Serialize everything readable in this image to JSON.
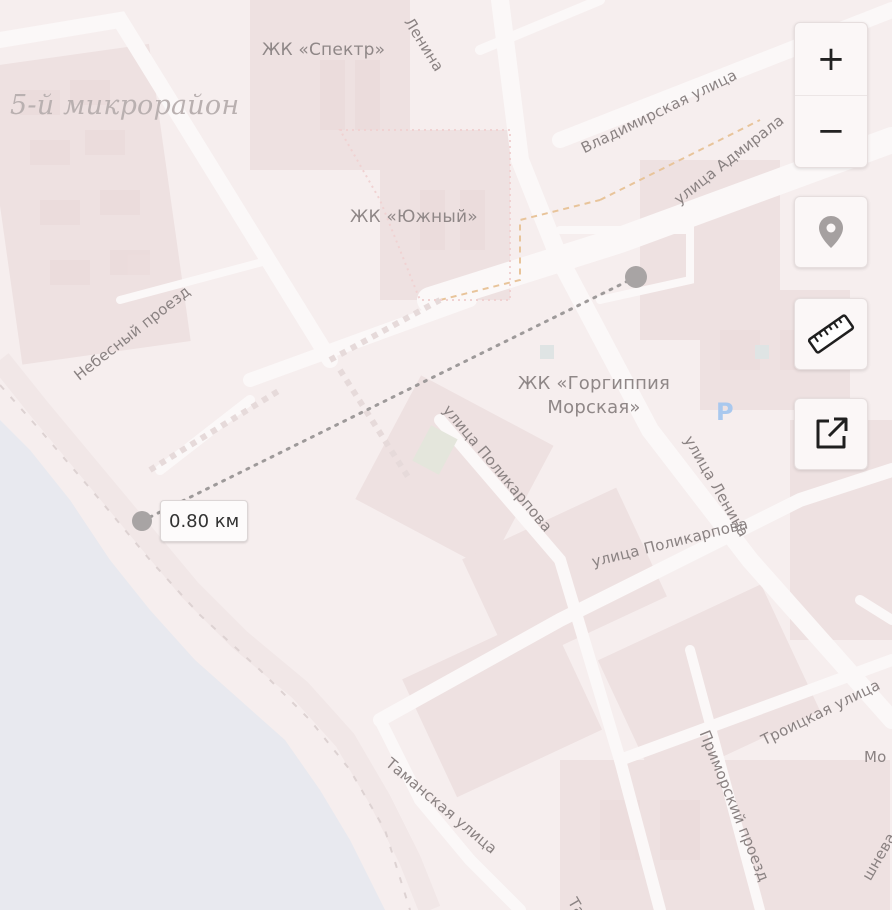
{
  "map": {
    "labels": {
      "district": "5-й микрорайон",
      "zk_spektr": "ЖК «Спектр»",
      "zk_yuzhny": "ЖК «Южный»",
      "zk_gorgippia_line1": "ЖК «Горгиппия",
      "zk_gorgippia_line2": "Морская»",
      "parking": "P",
      "vladimirskaya": "Владимирская улица",
      "admirala": "улица Адмирала",
      "lenina_top": "Ленина",
      "lenina": "улица Ленина",
      "nebesny": "Небесный проезд",
      "polikarpova_1": "улица Поликарпова",
      "polikarpova_2": "улица Поликарпова",
      "troitskaya": "Троицкая улица",
      "primorsky": "Приморский проезд",
      "tamanskaya": "Таманская улица",
      "edge_mo": "Мо",
      "edge_shneva": "шнева",
      "edge_ta": "Та"
    },
    "water_color": "#e8e9ef",
    "land_color": "#f6eeee"
  },
  "ruler": {
    "distance_label": "0.80 км",
    "line_color": "#9e9a9a"
  },
  "controls": {
    "zoom_in_label": "+",
    "zoom_out_label": "−",
    "locate_icon": "map-pin-icon",
    "ruler_icon": "ruler-icon",
    "open_external_icon": "open-external-icon"
  }
}
